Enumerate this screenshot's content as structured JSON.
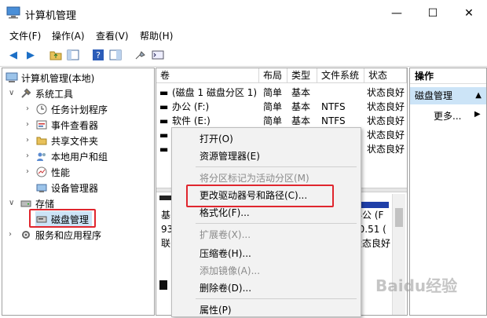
{
  "window": {
    "title": "计算机管理",
    "min": "—",
    "max": "☐",
    "close": "✕"
  },
  "menu": [
    "文件(F)",
    "操作(A)",
    "查看(V)",
    "帮助(H)"
  ],
  "tree": {
    "root": "计算机管理(本地)",
    "system_tools": "系统工具",
    "task_scheduler": "任务计划程序",
    "event_viewer": "事件查看器",
    "shared_folders": "共享文件夹",
    "local_users": "本地用户和组",
    "performance": "性能",
    "device_manager": "设备管理器",
    "storage": "存储",
    "disk_management": "磁盘管理",
    "services_apps": "服务和应用程序"
  },
  "columns": [
    "卷",
    "布局",
    "类型",
    "文件系统",
    "状态"
  ],
  "volumes": [
    {
      "name": "(磁盘 1 磁盘分区 1)",
      "layout": "简单",
      "type": "基本",
      "fs": "",
      "status": "状态良好"
    },
    {
      "name": "办公 (F:)",
      "layout": "简单",
      "type": "基本",
      "fs": "NTFS",
      "status": "状态良好"
    },
    {
      "name": "软件 (E:)",
      "layout": "简单",
      "type": "基本",
      "fs": "NTFS",
      "status": "状态良好"
    },
    {
      "name": "",
      "layout": "",
      "type": "",
      "fs": "",
      "status": "状态良好"
    },
    {
      "name": "",
      "layout": "",
      "type": "",
      "fs": "",
      "status": "状态良好"
    }
  ],
  "lower_pane": {
    "disk_left_1": "基",
    "disk_left_2": "93",
    "disk_left_3": "联",
    "part_name": "办公 (F",
    "part_size": "10.51 (",
    "part_status": "状态良好"
  },
  "actions": {
    "header": "操作",
    "section": "磁盘管理",
    "more": "更多..."
  },
  "context_menu": [
    {
      "label": "打开(O)",
      "disabled": false
    },
    {
      "label": "资源管理器(E)",
      "disabled": false
    },
    {
      "label": "将分区标记为活动分区(M)",
      "disabled": true
    },
    {
      "label": "更改驱动器号和路径(C)...",
      "disabled": false
    },
    {
      "label": "格式化(F)...",
      "disabled": false
    },
    {
      "label": "扩展卷(X)...",
      "disabled": true
    },
    {
      "label": "压缩卷(H)...",
      "disabled": false
    },
    {
      "label": "添加镜像(A)...",
      "disabled": true
    },
    {
      "label": "删除卷(D)...",
      "disabled": false
    },
    {
      "label": "属性(P)",
      "disabled": false
    }
  ],
  "watermark": "Baidu经验",
  "colors": {
    "accent_blue": "#1c6fc6",
    "highlight_red": "#e0262e",
    "selected_bg": "#cce4f7"
  }
}
